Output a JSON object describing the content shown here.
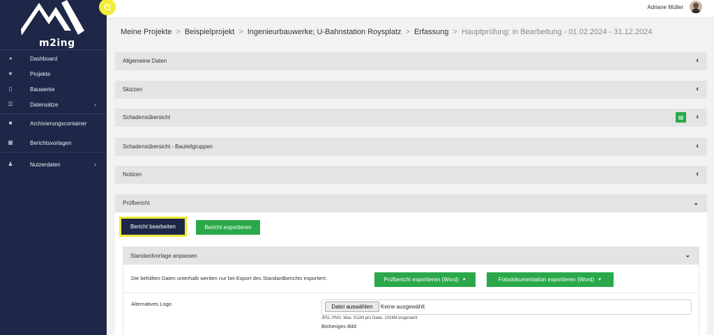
{
  "app": {
    "logo_text": "m2ing",
    "toggle_icon": "power-icon"
  },
  "sidebar": {
    "items": [
      {
        "label": "Dashboard",
        "icon": "dashboard-icon",
        "glyph": "◕",
        "has_children": false
      },
      {
        "label": "Projekte",
        "icon": "star-icon",
        "glyph": "★",
        "has_children": false
      },
      {
        "label": "Bauwerke",
        "icon": "building-icon",
        "glyph": "▯",
        "has_children": false
      },
      {
        "label": "Datensätze",
        "icon": "list-icon",
        "glyph": "☰",
        "has_children": true
      },
      {
        "label": "Archivierungscontainer",
        "icon": "archive-icon",
        "glyph": "■",
        "has_children": false
      },
      {
        "label": "Berichtsvorlagen",
        "icon": "table-icon",
        "glyph": "▦",
        "has_children": false
      },
      {
        "label": "Nutzerdaten",
        "icon": "user-icon",
        "glyph": "♟",
        "has_children": true
      }
    ]
  },
  "topbar": {
    "user_name": "Adriane Müller"
  },
  "breadcrumb": {
    "items": [
      "Meine Projekte",
      "Beispielprojekt",
      "Ingenieurbauwerke; U-Bahnstation Roysplatz",
      "Erfassung"
    ],
    "current": "Hauptprüfung: in Bearbeitung - 01.02.2024 - 31.12.2024",
    "separator": ">"
  },
  "panels": {
    "allgemeine_daten": "Allgemeine Daten",
    "skizzen": "Skizzen",
    "schadensuebersicht": "Schadensübersicht",
    "schadensuebersicht_bauteilgruppen": "Schadensübersicht - Bauteilgruppen",
    "notizen": "Notizen",
    "pruefbericht": "Prüfbericht"
  },
  "pruefbericht": {
    "edit_button": "Bericht bearbeiten",
    "export_button": "Bericht exportieren",
    "standardvorlage": {
      "title": "Standardvorlage anpassen",
      "info": "Die befüllten Daten unterhalb werden nur bei Export des Standardberichts exportiert.",
      "export_word_button": "Prüfbericht exportieren (Word)",
      "export_foto_button": "Fotodokumentation exportieren (Word)",
      "alt_logo_label": "Alternatives Logo",
      "file_button": "Datei auswählen",
      "file_none": "Keine ausgewählt",
      "hint": "JPG, PNG. Max. 512M pro Datei. 1024M insgesamt",
      "previous_image_label": "Bisheriges Bild:"
    }
  },
  "colors": {
    "sidebar": "#1e2747",
    "accent_yellow": "#efe837",
    "green": "#2aa84a"
  }
}
